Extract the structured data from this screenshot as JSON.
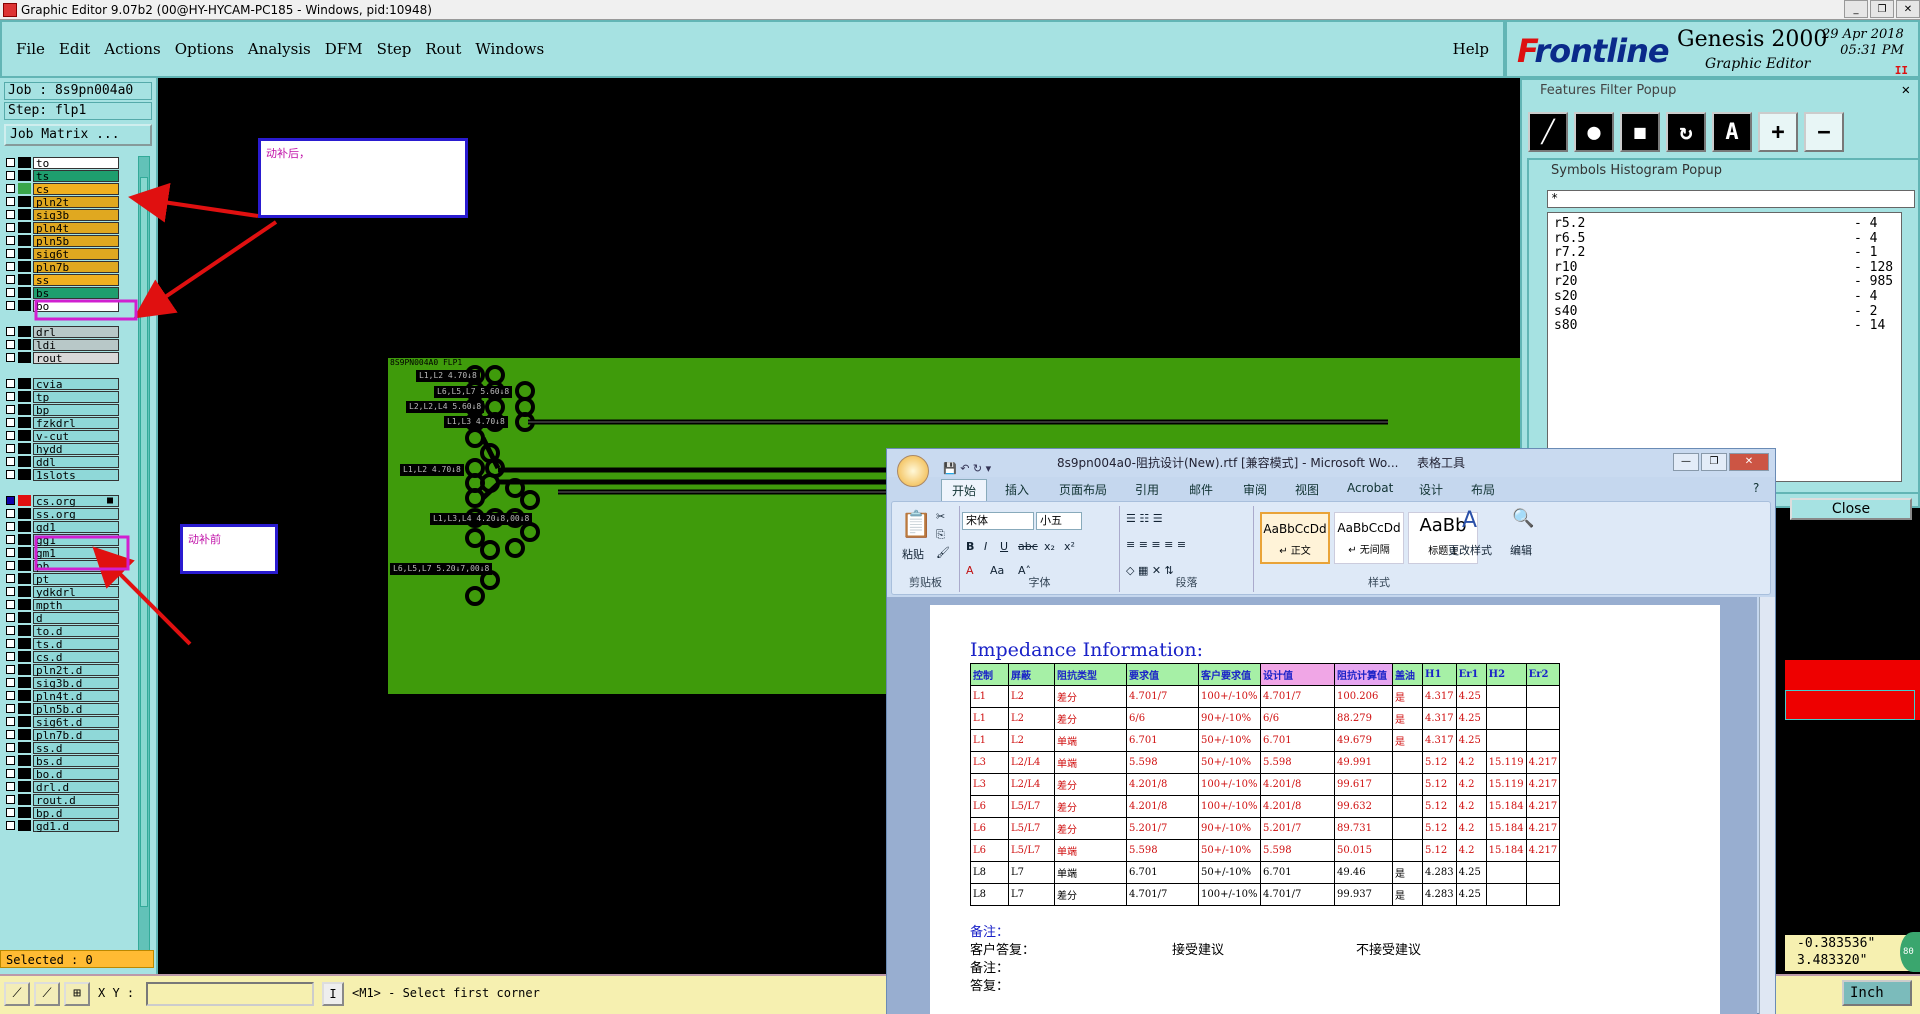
{
  "window": {
    "title": "Graphic Editor 9.07b2 (00@HY-HYCAM-PC185 - Windows, pid:10948)"
  },
  "menu": {
    "items": [
      "File",
      "Edit",
      "Actions",
      "Options",
      "Analysis",
      "DFM",
      "Step",
      "Rout",
      "Windows"
    ],
    "help": "Help"
  },
  "brand": {
    "logo_f": "F",
    "logo_rest": "rontline",
    "product": "Genesis 2000",
    "subtitle": "Graphic Editor",
    "date": "29 Apr 2018",
    "time": "05:31 PM",
    "pause": "II"
  },
  "left": {
    "job": "Job : 8s9pn004a0",
    "step": "Step: flp1",
    "job_matrix": "Job Matrix ...",
    "selected": "Selected : 0",
    "layers": [
      {
        "name": "to",
        "color": "#ffffff"
      },
      {
        "name": "ts",
        "color": "#1e9e6e"
      },
      {
        "name": "cs",
        "color": "#f0b020",
        "sw": "#3aa64a"
      },
      {
        "name": "pln2t",
        "color": "#e0a820"
      },
      {
        "name": "sig3b",
        "color": "#e0a820"
      },
      {
        "name": "pln4t",
        "color": "#e0a820"
      },
      {
        "name": "pln5b",
        "color": "#e0a820"
      },
      {
        "name": "sig6t",
        "color": "#e0a820"
      },
      {
        "name": "pln7b",
        "color": "#e0a820"
      },
      {
        "name": "ss",
        "color": "#f0b020"
      },
      {
        "name": "bs",
        "color": "#1e9e6e"
      },
      {
        "name": "bo",
        "color": "#ffffff"
      },
      {
        "name": "",
        "color": ""
      },
      {
        "name": "drl",
        "color": "#b8c8c8"
      },
      {
        "name": "ldi",
        "color": "#b8c8c8"
      },
      {
        "name": "rout",
        "color": "#d8d8d8"
      },
      {
        "name": "",
        "color": ""
      },
      {
        "name": "cvia",
        "color": "#8fd8d8"
      },
      {
        "name": "tp",
        "color": "#8fd8d8"
      },
      {
        "name": "bp",
        "color": "#8fd8d8"
      },
      {
        "name": "fzkdrl",
        "color": "#8fd8d8"
      },
      {
        "name": "v-cut",
        "color": "#8fd8d8"
      },
      {
        "name": "hydd",
        "color": "#8fd8d8"
      },
      {
        "name": "ddl",
        "color": "#8fd8d8"
      },
      {
        "name": "1slots",
        "color": "#8fd8d8"
      },
      {
        "name": "",
        "color": ""
      },
      {
        "name": "cs.org",
        "color": "#8fd8d8",
        "sw": "#e01010",
        "chk": true,
        "mark": "■"
      },
      {
        "name": "ss.org",
        "color": "#8fd8d8"
      },
      {
        "name": "gd1",
        "color": "#8fd8d8"
      },
      {
        "name": "gg1",
        "color": "#8fd8d8"
      },
      {
        "name": "gm1",
        "color": "#8fd8d8"
      },
      {
        "name": "pb",
        "color": "#8fd8d8"
      },
      {
        "name": "pt",
        "color": "#8fd8d8"
      },
      {
        "name": "ydkdrl",
        "color": "#8fd8d8"
      },
      {
        "name": "mpth",
        "color": "#8fd8d8"
      },
      {
        "name": "d",
        "color": "#8fd8d8"
      },
      {
        "name": "to.d",
        "color": "#8fd8d8"
      },
      {
        "name": "ts.d",
        "color": "#8fd8d8"
      },
      {
        "name": "cs.d",
        "color": "#8fd8d8"
      },
      {
        "name": "pln2t.d",
        "color": "#8fd8d8"
      },
      {
        "name": "sig3b.d",
        "color": "#8fd8d8"
      },
      {
        "name": "pln4t.d",
        "color": "#8fd8d8"
      },
      {
        "name": "pln5b.d",
        "color": "#8fd8d8"
      },
      {
        "name": "sig6t.d",
        "color": "#8fd8d8"
      },
      {
        "name": "pln7b.d",
        "color": "#8fd8d8"
      },
      {
        "name": "ss.d",
        "color": "#8fd8d8"
      },
      {
        "name": "bs.d",
        "color": "#8fd8d8"
      },
      {
        "name": "bo.d",
        "color": "#8fd8d8"
      },
      {
        "name": "drl.d",
        "color": "#8fd8d8"
      },
      {
        "name": "rout.d",
        "color": "#8fd8d8"
      },
      {
        "name": "bp.d",
        "color": "#8fd8d8"
      },
      {
        "name": "gd1.d",
        "color": "#8fd8d8"
      }
    ]
  },
  "canvas": {
    "board_title": "8S9PN004A0 FLP1",
    "tags": [
      "L1,L2 4.70↓8",
      "L6,L5,L7 5.60↓8",
      "L2,L2,L4 5.60↓8",
      "L1,L3 4.70↓8",
      "L1,L2 4.70↓8",
      "L1,L3,L4 4.20↓8,00↓8",
      "L6,L5,L7 5.20↓7,00↓8"
    ],
    "annot_after": "动补后，",
    "annot_before": "动补前"
  },
  "features_filter": {
    "title": "Features Filter Popup",
    "close": "Close"
  },
  "symbols_histogram": {
    "title": "Symbols Histogram Popup",
    "filter": "*",
    "rows": [
      {
        "sym": "r5.2",
        "count": "- 4"
      },
      {
        "sym": "r6.5",
        "count": "- 4"
      },
      {
        "sym": "r7.2",
        "count": "- 1"
      },
      {
        "sym": "r10",
        "count": "- 128"
      },
      {
        "sym": "r20",
        "count": "- 985"
      },
      {
        "sym": "s20",
        "count": "- 4"
      },
      {
        "sym": "s40",
        "count": "- 2"
      },
      {
        "sym": "s80",
        "count": "- 14"
      }
    ]
  },
  "status": {
    "xy_label": "X Y :",
    "caret": "I",
    "message": "<M1> - Select first corner",
    "coord_x": "-0.383536\"",
    "coord_y": "3.483320\"",
    "units": "Inch"
  },
  "word": {
    "title": "8s9pn004a0-阻抗设计(New).rtf [兼容模式] - Microsoft Wo...",
    "table_tools": "表格工具",
    "tabs": [
      "开始",
      "插入",
      "页面布局",
      "引用",
      "邮件",
      "审阅",
      "视图",
      "Acrobat",
      "设计",
      "布局"
    ],
    "font": "宋体",
    "size": "小五",
    "groups": [
      "剪贴板",
      "字体",
      "段落",
      "样式"
    ],
    "paste": "粘贴",
    "styles": [
      {
        "sample": "AaBbCcDd",
        "name": "↵ 正文"
      },
      {
        "sample": "AaBbCcDd",
        "name": "↵ 无间隔"
      },
      {
        "sample": "AaBb",
        "name": "标题 1"
      }
    ],
    "change_styles": "更改样式",
    "edit": "编辑",
    "heading": "Impedance Information:",
    "columns": [
      "控制",
      "屏蔽",
      "阻抗类型",
      "要求值",
      "客户要求值",
      "设计值",
      "阻抗计算值",
      "盖油",
      "H1",
      "Er1",
      "H2",
      "Er2"
    ],
    "rows": [
      [
        "L1",
        "L2",
        "差分",
        "4.701/7",
        "100+/-10%",
        "4.701/7",
        "100.206",
        "是",
        "4.317",
        "4.25",
        "",
        ""
      ],
      [
        "L1",
        "L2",
        "差分",
        "6/6",
        "90+/-10%",
        "6/6",
        "88.279",
        "是",
        "4.317",
        "4.25",
        "",
        ""
      ],
      [
        "L1",
        "L2",
        "单端",
        "6.701",
        "50+/-10%",
        "6.701",
        "49.679",
        "是",
        "4.317",
        "4.25",
        "",
        ""
      ],
      [
        "L3",
        "L2/L4",
        "单端",
        "5.598",
        "50+/-10%",
        "5.598",
        "49.991",
        "",
        "5.12",
        "4.2",
        "15.119",
        "4.217"
      ],
      [
        "L3",
        "L2/L4",
        "差分",
        "4.201/8",
        "100+/-10%",
        "4.201/8",
        "99.617",
        "",
        "5.12",
        "4.2",
        "15.119",
        "4.217"
      ],
      [
        "L6",
        "L5/L7",
        "差分",
        "4.201/8",
        "100+/-10%",
        "4.201/8",
        "99.632",
        "",
        "5.12",
        "4.2",
        "15.184",
        "4.217"
      ],
      [
        "L6",
        "L5/L7",
        "差分",
        "5.201/7",
        "90+/-10%",
        "5.201/7",
        "89.731",
        "",
        "5.12",
        "4.2",
        "15.184",
        "4.217"
      ],
      [
        "L6",
        "L5/L7",
        "单端",
        "5.598",
        "50+/-10%",
        "5.598",
        "50.015",
        "",
        "5.12",
        "4.2",
        "15.184",
        "4.217"
      ],
      [
        "L8",
        "L7",
        "单端",
        "6.701",
        "50+/-10%",
        "6.701",
        "49.46",
        "是",
        "4.283",
        "4.25",
        "",
        ""
      ],
      [
        "L8",
        "L7",
        "差分",
        "4.701/7",
        "100+/-10%",
        "4.701/7",
        "99.937",
        "是",
        "4.283",
        "4.25",
        "",
        ""
      ]
    ],
    "note1": "备注：",
    "reply_label": "客户答复：",
    "accept": "接受建议",
    "reject": "不接受建议",
    "note2": "备注：",
    "answer": "答复："
  }
}
